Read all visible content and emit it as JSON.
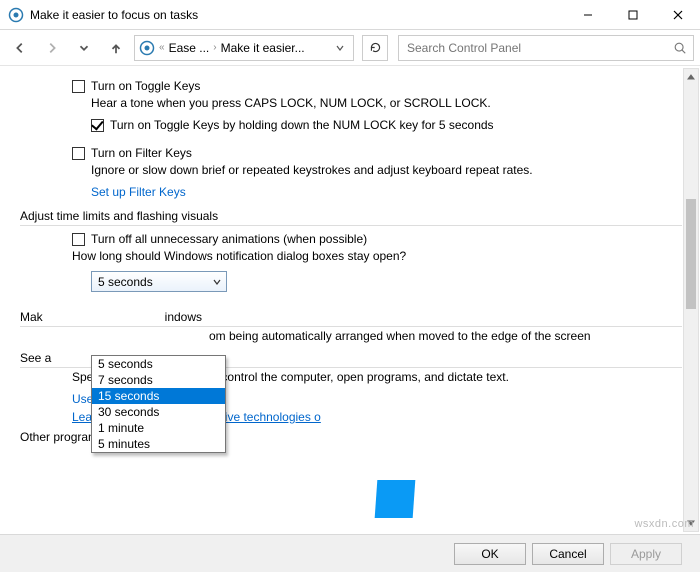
{
  "window": {
    "title": "Make it easier to focus on tasks",
    "minimize_tip": "Minimize",
    "maximize_tip": "Maximize",
    "close_tip": "Close"
  },
  "nav": {
    "crumb1": "Ease ...",
    "crumb2": "Make it easier...",
    "chevrons": "«",
    "search_placeholder": "Search Control Panel"
  },
  "toggleKeys": {
    "checkbox_label": "Turn on Toggle Keys",
    "desc": "Hear a tone when you press CAPS LOCK, NUM LOCK, or SCROLL LOCK.",
    "sub_checkbox_label": "Turn on Toggle Keys by holding down the NUM LOCK key for 5 seconds"
  },
  "filterKeys": {
    "checkbox_label": "Turn on Filter Keys",
    "desc": "Ignore or slow down brief or repeated keystrokes and adjust keyboard repeat rates.",
    "link": "Set up Filter Keys"
  },
  "timeLimits": {
    "heading": "Adjust time limits and flashing visuals",
    "anim_checkbox_label": "Turn off all unnecessary animations (when possible)",
    "question": "How long should Windows notification dialog boxes stay open?",
    "combo_value": "5 seconds",
    "options": [
      "5 seconds",
      "7 seconds",
      "15 seconds",
      "30 seconds",
      "1 minute",
      "5 minutes"
    ],
    "highlighted_index": 2
  },
  "windowsMgmt": {
    "heading_partial": "Mak",
    "heading_partial2": "indows",
    "desc_partial": "om being automatically arranged when moved to the edge of the screen"
  },
  "seeAlso": {
    "heading": "See a",
    "desc": "Speak into a microphone to control the computer, open programs, and dictate text.",
    "link1": "Use Speech Recognition",
    "link2": "Learn about additional assistive technologies o"
  },
  "other_heading": "Other programs installed",
  "footer": {
    "ok": "OK",
    "cancel": "Cancel",
    "apply": "Apply"
  },
  "watermark": "wsxdn.com"
}
